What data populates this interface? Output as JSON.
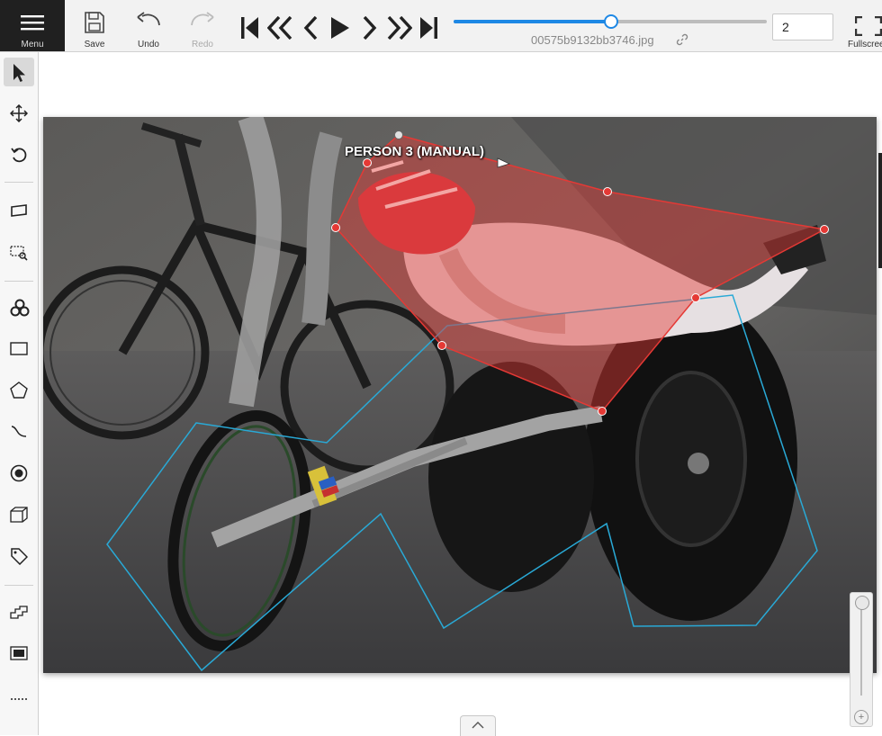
{
  "toolbar": {
    "menu_label": "Menu",
    "save_label": "Save",
    "undo_label": "Undo",
    "redo_label": "Redo",
    "fullscreen_label": "Fullscreen",
    "filename": "00575b9132bb3746.jpg",
    "frame_value": "2",
    "player_progress": 0.5
  },
  "canvas": {
    "shape_label": "PERSON 3 (MANUAL)",
    "colors": {
      "active_shape": "#e53935",
      "other_shape": "#29a9d6"
    }
  },
  "sidebar": {
    "tools": [
      "cursor-icon",
      "move-icon",
      "rotate-icon",
      "fit-image-icon",
      "zoom-region-icon",
      "ai-tools-icon",
      "rectangle-icon",
      "polygon-icon",
      "polyline-icon",
      "points-icon",
      "cuboid-icon",
      "tag-icon",
      "merge-icon",
      "group-icon",
      "more-icon"
    ]
  },
  "colors": {
    "accent": "#1e88e5",
    "menu_bg": "#202020"
  }
}
